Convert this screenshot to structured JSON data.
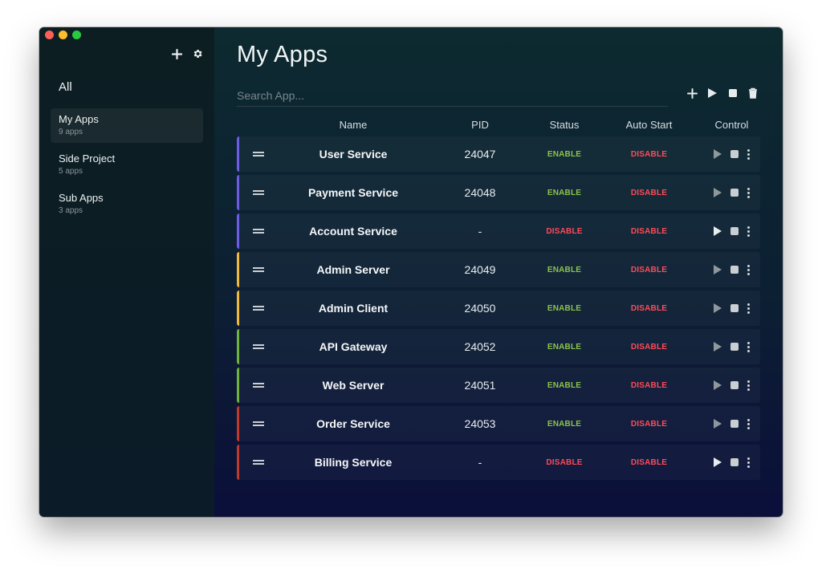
{
  "sidebar": {
    "all_label": "All",
    "groups": [
      {
        "name": "My Apps",
        "count": "9 apps",
        "active": true
      },
      {
        "name": "Side Project",
        "count": "5 apps",
        "active": false
      },
      {
        "name": "Sub Apps",
        "count": "3 apps",
        "active": false
      }
    ],
    "icons": [
      "plus-icon",
      "gear-icon"
    ]
  },
  "main": {
    "title": "My Apps",
    "search_placeholder": "Search App...",
    "toolbar_icons": [
      "plus-icon",
      "play-icon",
      "stop-icon",
      "trash-icon"
    ],
    "columns": {
      "name": "Name",
      "pid": "PID",
      "status": "Status",
      "auto_start": "Auto Start",
      "control": "Control"
    },
    "rows": [
      {
        "name": "User Service",
        "pid": "24047",
        "status": "ENABLE",
        "auto_start": "DISABLE",
        "accent": "#6c5ce7",
        "running": true
      },
      {
        "name": "Payment Service",
        "pid": "24048",
        "status": "ENABLE",
        "auto_start": "DISABLE",
        "accent": "#6c5ce7",
        "running": true
      },
      {
        "name": "Account Service",
        "pid": "-",
        "status": "DISABLE",
        "auto_start": "DISABLE",
        "accent": "#6c5ce7",
        "running": false
      },
      {
        "name": "Admin Server",
        "pid": "24049",
        "status": "ENABLE",
        "auto_start": "DISABLE",
        "accent": "#f1b93a",
        "running": true
      },
      {
        "name": "Admin Client",
        "pid": "24050",
        "status": "ENABLE",
        "auto_start": "DISABLE",
        "accent": "#f1b93a",
        "running": true
      },
      {
        "name": "API Gateway",
        "pid": "24052",
        "status": "ENABLE",
        "auto_start": "DISABLE",
        "accent": "#6fb33b",
        "running": true
      },
      {
        "name": "Web Server",
        "pid": "24051",
        "status": "ENABLE",
        "auto_start": "DISABLE",
        "accent": "#6fb33b",
        "running": true
      },
      {
        "name": "Order Service",
        "pid": "24053",
        "status": "ENABLE",
        "auto_start": "DISABLE",
        "accent": "#c0392b",
        "running": true
      },
      {
        "name": "Billing Service",
        "pid": "-",
        "status": "DISABLE",
        "auto_start": "DISABLE",
        "accent": "#c0392b",
        "running": false
      }
    ]
  },
  "colors": {
    "enable": "#8bc34a",
    "disable": "#ff4b57"
  }
}
